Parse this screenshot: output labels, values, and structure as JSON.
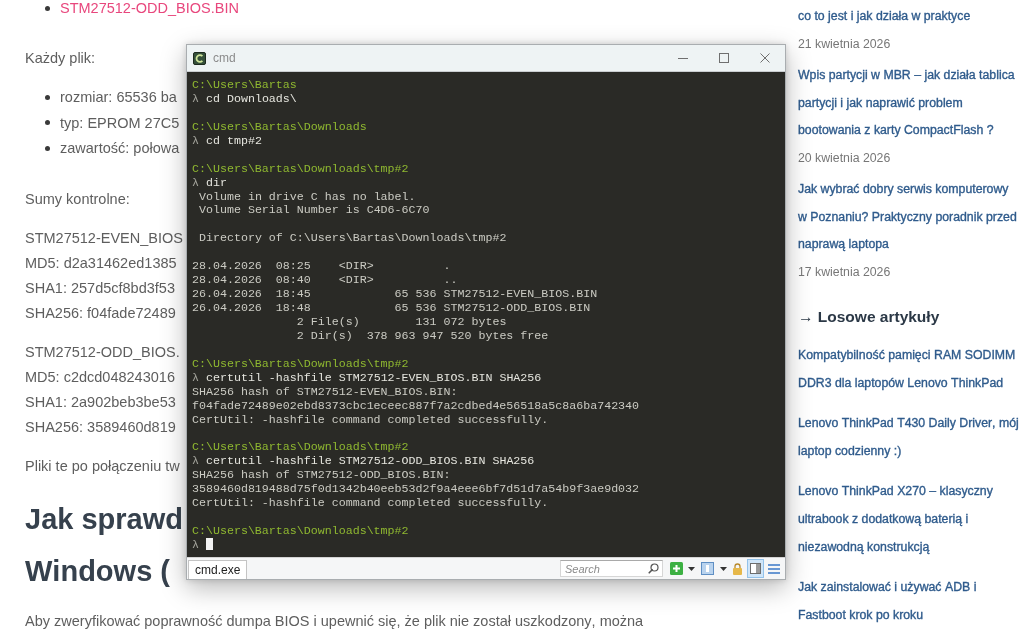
{
  "page": {
    "file_links": [
      "STM27512-ODD_BIOS.BIN"
    ],
    "intro": "Każdy plik:",
    "specs": [
      "rozmiar: 65536 ba",
      "typ: EPROM 27C5",
      "zawartość: połowa"
    ],
    "checksums_label": "Sumy kontrolne:",
    "checksum_blocks": [
      {
        "file": "STM27512-EVEN_BIOS",
        "hashes": [
          "MD5: d2a31462ed1385",
          "SHA1: 257d5cf8bd3f53",
          "SHA256: f04fade72489"
        ]
      },
      {
        "file": "STM27512-ODD_BIOS.",
        "hashes": [
          "MD5: c2dcd048243016",
          "SHA1: 2a902beb3be53",
          "SHA256: 3589460d819"
        ]
      }
    ],
    "note": "Pliki te po połączeniu tw",
    "heading_lines": [
      "Jak sprawd",
      "Windows ("
    ],
    "paragraph": "Aby zweryfikować poprawność dumpa BIOS i upewnić się, że plik nie został uszkodzony, można"
  },
  "sidebar": {
    "recent_posts": [
      {
        "title": "co to jest i jak działa w praktyce",
        "date": "21 kwietnia 2026"
      },
      {
        "title": "Wpis partycji w MBR – jak działa tablica partycji i jak naprawić problem bootowania z karty CompactFlash ?",
        "date": "20 kwietnia 2026"
      },
      {
        "title": "Jak wybrać dobry serwis komputerowy w Poznaniu? Praktyczny poradnik przed naprawą laptopa",
        "date": "17 kwietnia 2026"
      }
    ],
    "random_heading": "→ Losowe artykuły",
    "random_posts": [
      "Kompatybilność pamięci RAM SODIMM DDR3 dla laptopów Lenovo ThinkPad",
      "Lenovo ThinkPad T430 Daily Driver, mój laptop codzienny :)",
      "Lenovo ThinkPad X270 – klasyczny ultrabook z dodatkową baterią i niezawodną konstrukcją",
      "Jak zainstalować i używać ADB i Fastboot krok po kroku"
    ]
  },
  "window": {
    "title": "cmd",
    "console": {
      "lines": [
        {
          "kind": "path",
          "text": "C:\\Users\\Bartas"
        },
        {
          "kind": "command",
          "prompt": "λ",
          "text": "cd Downloads\\"
        },
        {
          "kind": "blank"
        },
        {
          "kind": "path",
          "text": "C:\\Users\\Bartas\\Downloads"
        },
        {
          "kind": "command",
          "prompt": "λ",
          "text": "cd tmp#2"
        },
        {
          "kind": "blank"
        },
        {
          "kind": "path",
          "text": "C:\\Users\\Bartas\\Downloads\\tmp#2"
        },
        {
          "kind": "command",
          "prompt": "λ",
          "text": "dir"
        },
        {
          "kind": "output",
          "text": " Volume in drive C has no label."
        },
        {
          "kind": "output",
          "text": " Volume Serial Number is C4D6-6C70"
        },
        {
          "kind": "blank"
        },
        {
          "kind": "output",
          "text": " Directory of C:\\Users\\Bartas\\Downloads\\tmp#2"
        },
        {
          "kind": "blank"
        },
        {
          "kind": "output",
          "text": "28.04.2026  08:25    <DIR>          ."
        },
        {
          "kind": "output",
          "text": "28.04.2026  08:40    <DIR>          .."
        },
        {
          "kind": "output",
          "text": "26.04.2026  18:45            65 536 STM27512-EVEN_BIOS.BIN"
        },
        {
          "kind": "output",
          "text": "26.04.2026  18:48            65 536 STM27512-ODD_BIOS.BIN"
        },
        {
          "kind": "output",
          "text": "               2 File(s)        131 072 bytes"
        },
        {
          "kind": "output",
          "text": "               2 Dir(s)  378 963 947 520 bytes free"
        },
        {
          "kind": "blank"
        },
        {
          "kind": "path",
          "text": "C:\\Users\\Bartas\\Downloads\\tmp#2"
        },
        {
          "kind": "command",
          "prompt": "λ",
          "text": "certutil -hashfile STM27512-EVEN_BIOS.BIN SHA256"
        },
        {
          "kind": "output",
          "text": "SHA256 hash of STM27512-EVEN_BIOS.BIN:"
        },
        {
          "kind": "output",
          "text": "f04fade72489e02ebd8373cbc1eceec887f7a2cdbed4e56518a5c8a6ba742340"
        },
        {
          "kind": "output",
          "text": "CertUtil: -hashfile command completed successfully."
        },
        {
          "kind": "blank"
        },
        {
          "kind": "path",
          "text": "C:\\Users\\Bartas\\Downloads\\tmp#2"
        },
        {
          "kind": "command",
          "prompt": "λ",
          "text": "certutil -hashfile STM27512-ODD_BIOS.BIN SHA256"
        },
        {
          "kind": "output",
          "text": "SHA256 hash of STM27512-ODD_BIOS.BIN:"
        },
        {
          "kind": "output",
          "text": "3589460d819488d75f0d1342b40eeb53d2f9a4eee6bf7d51d7a54b9f3ae9d032"
        },
        {
          "kind": "output",
          "text": "CertUtil: -hashfile command completed successfully."
        },
        {
          "kind": "blank"
        },
        {
          "kind": "path",
          "text": "C:\\Users\\Bartas\\Downloads\\tmp#2"
        },
        {
          "kind": "cursor",
          "prompt": "λ"
        }
      ]
    },
    "status_bar": {
      "tabs": [
        {
          "label": "cmd.exe",
          "selected": true
        }
      ],
      "search": {
        "placeholder": "Search"
      },
      "split_view_on": true
    }
  }
}
